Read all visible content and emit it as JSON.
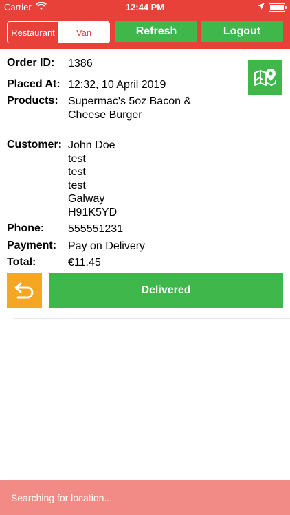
{
  "status_bar": {
    "carrier": "Carrier",
    "time": "12:44 PM"
  },
  "header": {
    "segment": {
      "options": [
        "Restaurant",
        "Van"
      ],
      "selected": "Restaurant"
    },
    "refresh_label": "Refresh",
    "logout_label": "Logout"
  },
  "order": {
    "order_id_label": "Order ID:",
    "order_id": "1386",
    "placed_at_label": "Placed At:",
    "placed_at": "12:32, 10 April 2019",
    "products_label": "Products:",
    "products_line1": "Supermac's 5oz Bacon &",
    "products_line2": "Cheese Burger",
    "customer_label": "Customer:",
    "customer_lines": [
      "John Doe",
      "test",
      "test",
      "test",
      "Galway",
      "H91K5YD"
    ],
    "phone_label": "Phone:",
    "phone": "555551231",
    "payment_label": "Payment:",
    "payment": "Pay on Delivery",
    "total_label": "Total:",
    "total": "€11.45"
  },
  "actions": {
    "delivered_label": "Delivered"
  },
  "footer": {
    "status_text": "Searching for location..."
  },
  "colors": {
    "header_red": "#e8413a",
    "green": "#3fb74b",
    "orange": "#f5a623",
    "footer_pink": "#f28b85"
  },
  "icons": {
    "map": "map-pin-icon",
    "back": "undo-arrow-icon"
  }
}
